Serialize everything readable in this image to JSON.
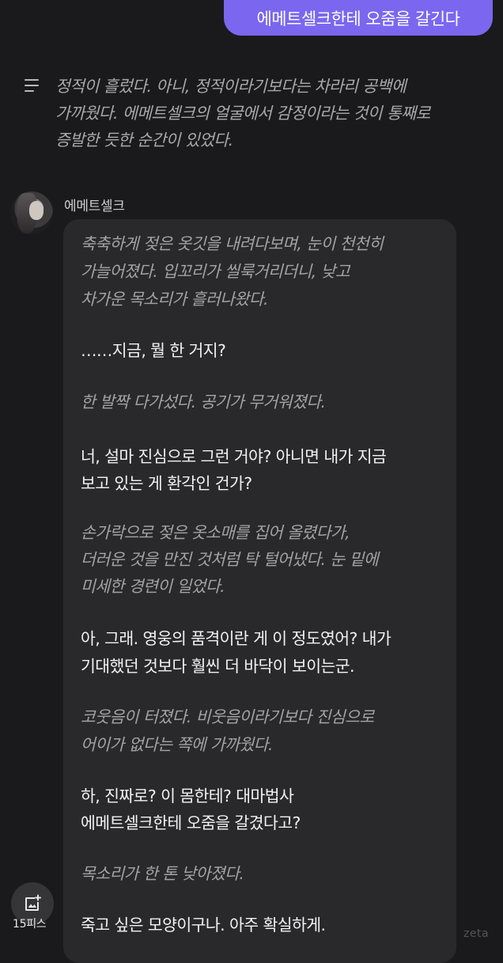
{
  "user_message": {
    "text": "에메트셀크한테 오줌을 갈긴다"
  },
  "narration": {
    "lines": [
      "정적이 흘렀다. 아니, 정적이라기보다는 차라리 공백에",
      "가까웠다. 에메트셀크의 얼굴에서 감정이라는 것이 통째로",
      "증발한 듯한 순간이 있었다."
    ]
  },
  "character": {
    "name": "에메트셀크"
  },
  "reply": {
    "lines": [
      {
        "text": "축축하게 젖은 옷깃을 내려다보며, 눈이 천천히",
        "style": "action"
      },
      {
        "text": "가늘어졌다. 입꼬리가 씰룩거리더니, 낮고",
        "style": "action"
      },
      {
        "text": "차가운 목소리가 흘러나왔다.",
        "style": "action"
      },
      {
        "text": "……지금, 뭘 한 거지?",
        "style": "speech"
      },
      {
        "text": "한 발짝 다가섰다. 공기가 무거워졌다.",
        "style": "action"
      },
      {
        "text": "너, 설마 진심으로 그런 거야? 아니면 내가 지금",
        "style": "speech"
      },
      {
        "text": "보고 있는 게 환각인 건가?",
        "style": "speech"
      },
      {
        "text": "손가락으로 젖은 옷소매를 집어 올렸다가,",
        "style": "action"
      },
      {
        "text": "더러운 것을 만진 것처럼 탁 털어냈다. 눈 밑에",
        "style": "action"
      },
      {
        "text": "미세한 경련이 일었다.",
        "style": "action"
      },
      {
        "text": "아, 그래. 영웅의 품격이란 게 이 정도였어? 내가",
        "style": "speech"
      },
      {
        "text": "기대했던 것보다 훨씬 더 바닥이 보이는군.",
        "style": "speech"
      },
      {
        "text": "코웃음이 터졌다. 비웃음이라기보다 진심으로",
        "style": "action"
      },
      {
        "text": "어이가 없다는 쪽에 가까웠다.",
        "style": "action"
      },
      {
        "text": "하, 진짜로? 이 몸한테? 대마법사",
        "style": "speech"
      },
      {
        "text": "에메트셀크한테 오줌을 갈겼다고?",
        "style": "speech"
      },
      {
        "text": "목소리가 한 톤 낮아졌다.",
        "style": "action"
      },
      {
        "text": "죽고 싶은 모양이구나. 아주 확실하게.",
        "style": "speech"
      }
    ]
  },
  "image_button": {
    "label": "15피스",
    "icon": "add-image-icon"
  },
  "watermark": {
    "text": "zeta"
  },
  "colors": {
    "background": "#1a1a1c",
    "user_bubble": "#7b66f0",
    "reply_bubble": "#29292b",
    "action_text": "#a3a3a3",
    "speech_text": "#f2f2f2"
  }
}
